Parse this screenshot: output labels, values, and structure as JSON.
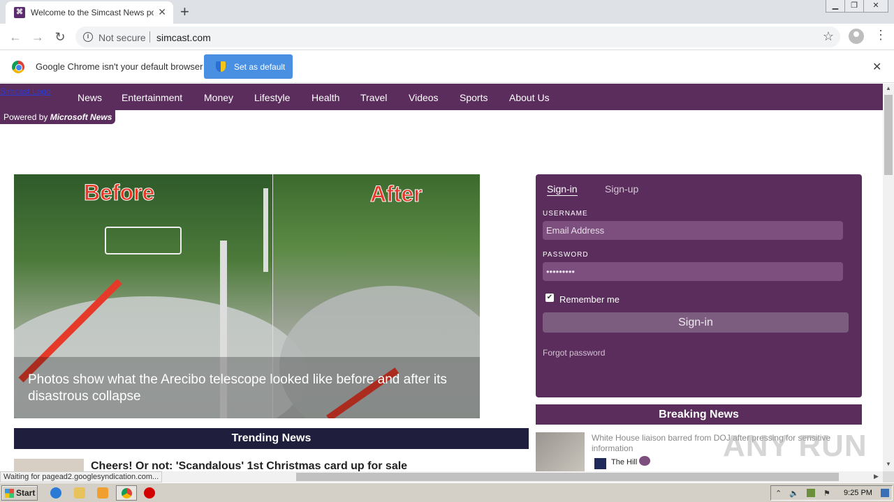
{
  "browser": {
    "tab_title": "Welcome to the Simcast News portal",
    "security_label": "Not secure",
    "url": "simcast.com"
  },
  "infobar": {
    "message": "Google Chrome isn't your default browser",
    "button_label": "Set as default"
  },
  "site": {
    "logo_alt": "Simcast Logo",
    "nav": [
      "News",
      "Entertainment",
      "Money",
      "Lifestyle",
      "Health",
      "Travel",
      "Videos",
      "Sports",
      "About Us"
    ],
    "powered_prefix": "Powered by",
    "powered_brand": "Microsoft News"
  },
  "hero": {
    "label_before": "Before",
    "label_after": "After",
    "caption": "Photos show what the Arecibo telescope looked like before and after its disastrous collapse"
  },
  "trending": {
    "heading": "Trending News",
    "first_title": "Cheers! Or not: 'Scandalous' 1st Christmas card up for sale"
  },
  "signin_panel": {
    "tab_signin": "Sign-in",
    "tab_signup": "Sign-up",
    "username_label": "USERNAME",
    "username_placeholder": "Email Address",
    "password_label": "PASSWORD",
    "password_value": "•••••••••",
    "remember_label": "Remember me",
    "remember_checked": true,
    "submit_label": "Sign-in",
    "forgot_label": "Forgot password"
  },
  "breaking": {
    "heading": "Breaking News",
    "first_title": "White House liaison barred from DOJ after pressing for sensitive information",
    "first_source": "The Hill"
  },
  "watermark": "ANY RUN",
  "status_text": "Waiting for pagead2.googlesyndication.com...",
  "taskbar": {
    "start_label": "Start",
    "clock": "9:25 PM"
  },
  "colors": {
    "brand_purple": "#5a2d5c",
    "trending_bar": "#1f1f3d",
    "infobar_button": "#4a90e2"
  }
}
